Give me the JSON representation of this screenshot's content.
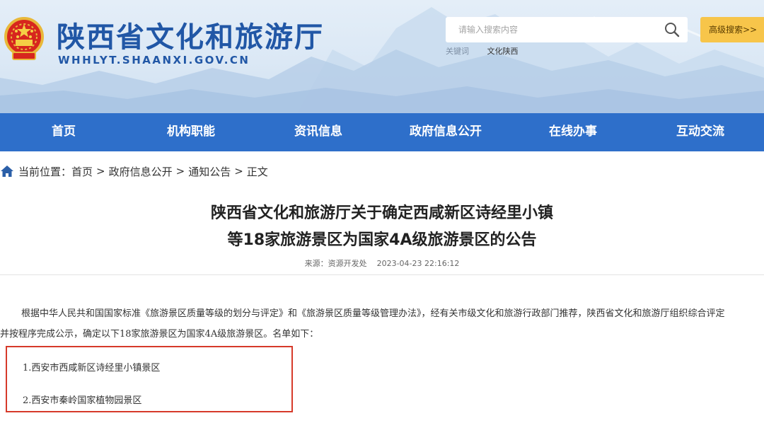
{
  "header": {
    "site_title": "陕西省文化和旅游厅",
    "site_domain": "WHHLYT.SHAANXI.GOV.CN",
    "search_placeholder": "请输入搜索内容",
    "advanced_search_label": "高级搜索>>",
    "hot_label": "关键词",
    "hot_keyword": "文化陕西"
  },
  "nav": {
    "items": [
      "首页",
      "机构职能",
      "资讯信息",
      "政府信息公开",
      "在线办事",
      "互动交流"
    ]
  },
  "breadcrumb": {
    "label": "当前位置：",
    "items": [
      "首页",
      "政府信息公开",
      "通知公告",
      "正文"
    ],
    "separator": ">"
  },
  "article": {
    "title_line1": "陕西省文化和旅游厅关于确定西咸新区诗经里小镇",
    "title_line2": "等18家旅游景区为国家4A级旅游景区的公告",
    "source": "来源：资源开发处",
    "date": "2023-04-23 22:16:12",
    "paragraph_line1": "根据中华人民共和国国家标准《旅游景区质量等级的划分与评定》和《旅游景区质量等级管理办法》，经有关市级文化和旅游行政部门推荐，陕西省文化和旅游厅组织综合评定",
    "paragraph_line2": "并按程序完成公示，确定以下18家旅游景区为国家4A级旅游景区。名单如下：",
    "list": [
      "1.西安市西咸新区诗经里小镇景区",
      "2.西安市秦岭国家植物园景区"
    ]
  },
  "colors": {
    "brand_blue": "#2157a6",
    "nav_blue": "#2e6fca",
    "advanced_button": "#f7c54a",
    "highlight_box": "#d63a2a"
  },
  "icons": {
    "emblem": "national-emblem-icon",
    "search": "search-icon",
    "home": "home-icon"
  }
}
